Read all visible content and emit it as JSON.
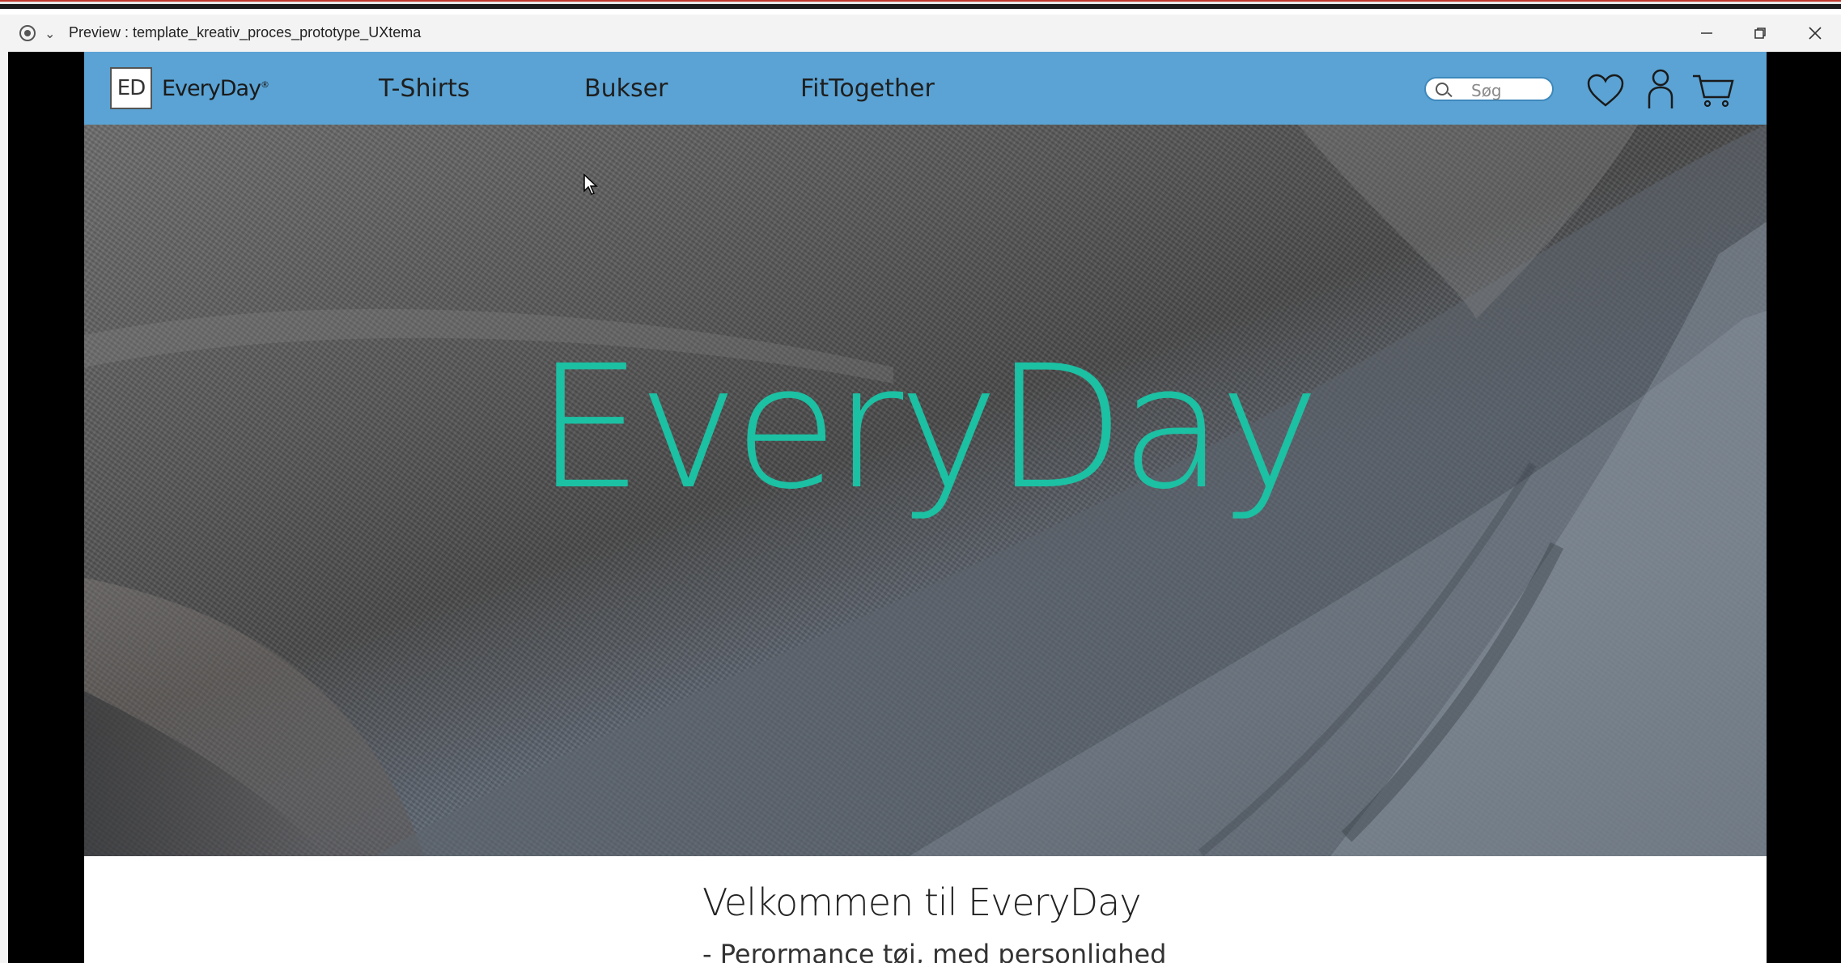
{
  "window": {
    "title": "Preview : template_kreativ_proces_prototype_UXtema",
    "minimize_icon": "minimize-icon",
    "restore_icon": "restore-icon",
    "close_icon": "close-icon"
  },
  "site": {
    "logo": {
      "mark": "ED",
      "name": "EveryDay",
      "trademark": "®"
    },
    "nav": [
      {
        "label": "T-Shirts"
      },
      {
        "label": "Bukser"
      },
      {
        "label": "FitTogether"
      }
    ],
    "search": {
      "placeholder": "Søg"
    },
    "icons": [
      "heart-icon",
      "user-icon",
      "cart-icon"
    ],
    "hero": {
      "title": "EveryDay",
      "accent_color": "#1cc0a3"
    },
    "welcome": {
      "title": "Velkommen til EveryDay",
      "subtitle": "- Perormance tøj, med personlighed"
    },
    "nav_color": "#5aa3d4"
  }
}
